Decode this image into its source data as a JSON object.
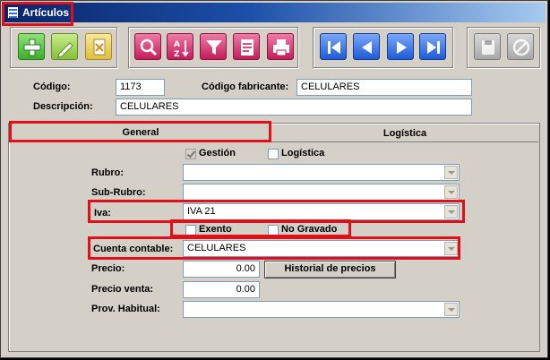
{
  "window": {
    "title": "Artículos"
  },
  "toolbar": {
    "new_icon": "plus-icon",
    "edit_icon": "pencil-icon",
    "delete_icon": "delete-document-icon",
    "search_icon": "magnifier-icon",
    "sort_icon": "sort-az-icon",
    "filter_icon": "funnel-icon",
    "report_icon": "clipboard-icon",
    "print_icon": "printer-icon",
    "first_icon": "first-record-icon",
    "prev_icon": "previous-record-icon",
    "next_icon": "next-record-icon",
    "last_icon": "last-record-icon",
    "save_icon": "save-disabled-icon",
    "cancel_icon": "cancel-disabled-icon"
  },
  "header": {
    "codigo_label": "Código:",
    "codigo_value": "1173",
    "codigo_fabricante_label": "Código fabricante:",
    "codigo_fabricante_value": "CELULARES",
    "descripcion_label": "Descripción:",
    "descripcion_value": "CELULARES"
  },
  "tabs": [
    {
      "label": "General",
      "active": true
    },
    {
      "label": "Logística",
      "active": false
    }
  ],
  "general": {
    "gestion_label": "Gestión",
    "gestion_checked": true,
    "logistica_label": "Logística",
    "logistica_checked": false,
    "rubro_label": "Rubro:",
    "rubro_value": "",
    "subrubro_label": "Sub-Rubro:",
    "subrubro_value": "",
    "iva_label": "Iva:",
    "iva_value": "IVA 21",
    "exento_label": "Exento",
    "exento_checked": false,
    "no_gravado_label": "No Gravado",
    "no_gravado_checked": false,
    "cuenta_label": "Cuenta contable:",
    "cuenta_value": "CELULARES",
    "precio_label": "Precio:",
    "precio_value": "0.00",
    "historial_button": "Historial de precios",
    "precio_venta_label": "Precio venta:",
    "precio_venta_value": "0.00",
    "prov_label": "Prov. Habitual:",
    "prov_value": ""
  },
  "colors": {
    "highlight": "#e0101a",
    "window_bg": "#d4d0c8",
    "titlebar": "#0a246a"
  }
}
